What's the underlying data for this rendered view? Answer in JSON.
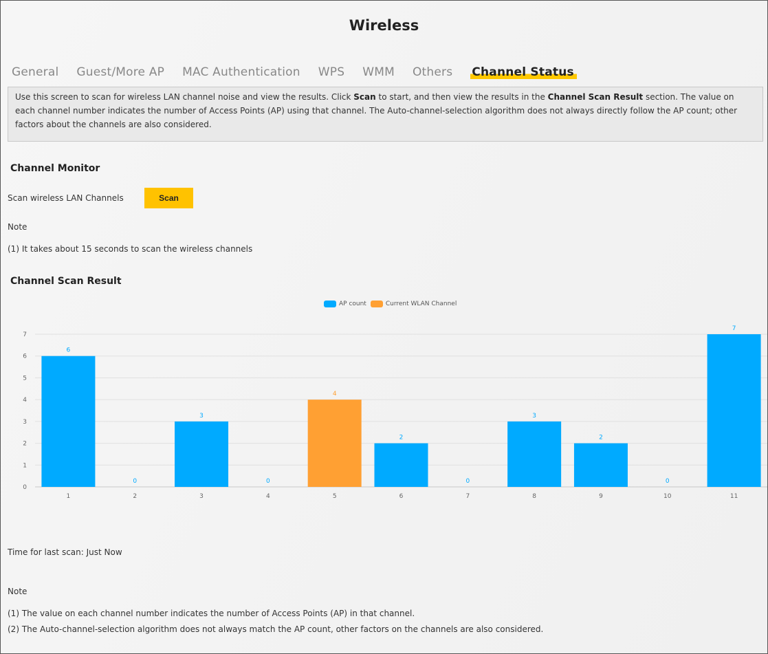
{
  "page": {
    "title": "Wireless"
  },
  "tabs": [
    "General",
    "Guest/More AP",
    "MAC Authentication",
    "WPS",
    "WMM",
    "Others",
    "Channel Status"
  ],
  "active_tab": "Channel Status",
  "description": {
    "part1": "Use this screen to scan for wireless LAN channel noise and view the results. Click ",
    "scan_word": "Scan",
    "part2": " to start, and then view the results in the ",
    "result_word": "Channel Scan Result",
    "part3": " section. The value on each channel number indicates the number of Access Points (AP) using that channel. The Auto-channel-selection algorithm does not always directly follow the AP count; other factors about the channels are also considered."
  },
  "channel_monitor": {
    "heading": "Channel Monitor",
    "scan_label": "Scan wireless LAN Channels",
    "scan_button": "Scan",
    "note_label": "Note",
    "note_line": "(1) It takes about 15 seconds to scan the wireless channels"
  },
  "scan_result": {
    "heading": "Channel Scan Result",
    "last_scan": "Time for last scan: Just Now",
    "note_label": "Note",
    "notes": [
      "(1) The value on each channel number indicates the number of Access Points (AP) in that channel.",
      "(2) The Auto-channel-selection algorithm does not always match the AP count, other factors on the channels are also considered."
    ]
  },
  "colors": {
    "ap_count": "#00aaff",
    "current_channel": "#ffa033",
    "accent": "#ffc200"
  },
  "chart_data": {
    "type": "bar",
    "categories": [
      "1",
      "2",
      "3",
      "4",
      "5",
      "6",
      "7",
      "8",
      "9",
      "10",
      "11"
    ],
    "series": [
      {
        "name": "AP count",
        "values": [
          6,
          0,
          3,
          0,
          4,
          2,
          0,
          3,
          2,
          0,
          7
        ]
      }
    ],
    "current_channel": "5",
    "legend": [
      "AP count",
      "Current WLAN Channel"
    ],
    "legend_position": "top-center",
    "ylim": [
      0,
      7
    ],
    "yticks": [
      0,
      1,
      2,
      3,
      4,
      5,
      6,
      7
    ],
    "grid": true,
    "data_labels": true
  }
}
